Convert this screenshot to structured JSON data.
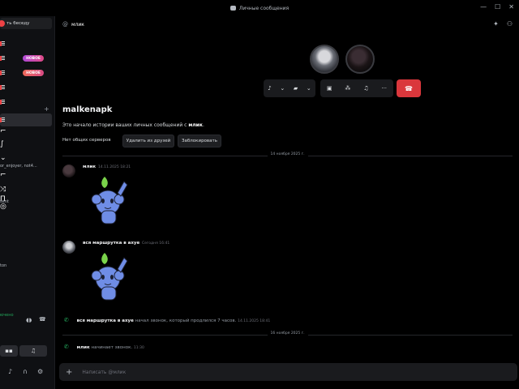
{
  "window": {
    "title": "Личные сообщения",
    "controls": [
      "—",
      "☐",
      "✕"
    ]
  },
  "sidebar": {
    "find_button": "ть беседу",
    "new_badge_1": "НОВОЕ",
    "new_badge_2": "НОВОЕ",
    "texts": [
      "or_enjoyer, not4...",
      "sent",
      "ton"
    ],
    "voice_connected": "ючено",
    "icons": [
      "list-icon",
      "plus-icon",
      "gamepad-icon",
      "mic-icon",
      "headphones-icon",
      "gear-icon"
    ]
  },
  "chat": {
    "header_name": "млик",
    "dm_title": "malkenapk",
    "intro_prefix": "Это начало истории ваших личных сообщений с",
    "intro_name": "млик",
    "intro_suffix": ".",
    "no_common_servers": "Нет общих серверов",
    "remove_friend": "Удалить из друзей",
    "block": "Заблокировать",
    "divider_1": "14 ноября 2025 г.",
    "divider_2": "16 ноября 2025 г.",
    "messages": [
      {
        "author": "млик",
        "time": "14.11.2025 18:21"
      },
      {
        "author": "вся маршрутка в ахуе",
        "time": "Сегодня 16:41"
      }
    ],
    "calls": [
      {
        "author": "вся маршрутка в ахуе",
        "text": "начал звонок, который продлился 7 часов.",
        "time": "14.11.2025 18:41"
      },
      {
        "author": "млик",
        "text": "начинает звонок.",
        "time": "11:30"
      }
    ],
    "composer_placeholder": "Написать @млик"
  },
  "colors": {
    "hangup": "#da373c",
    "accent_green": "#23a55a",
    "sticker": "#6f8de6",
    "leaf": "#7ad34a"
  }
}
